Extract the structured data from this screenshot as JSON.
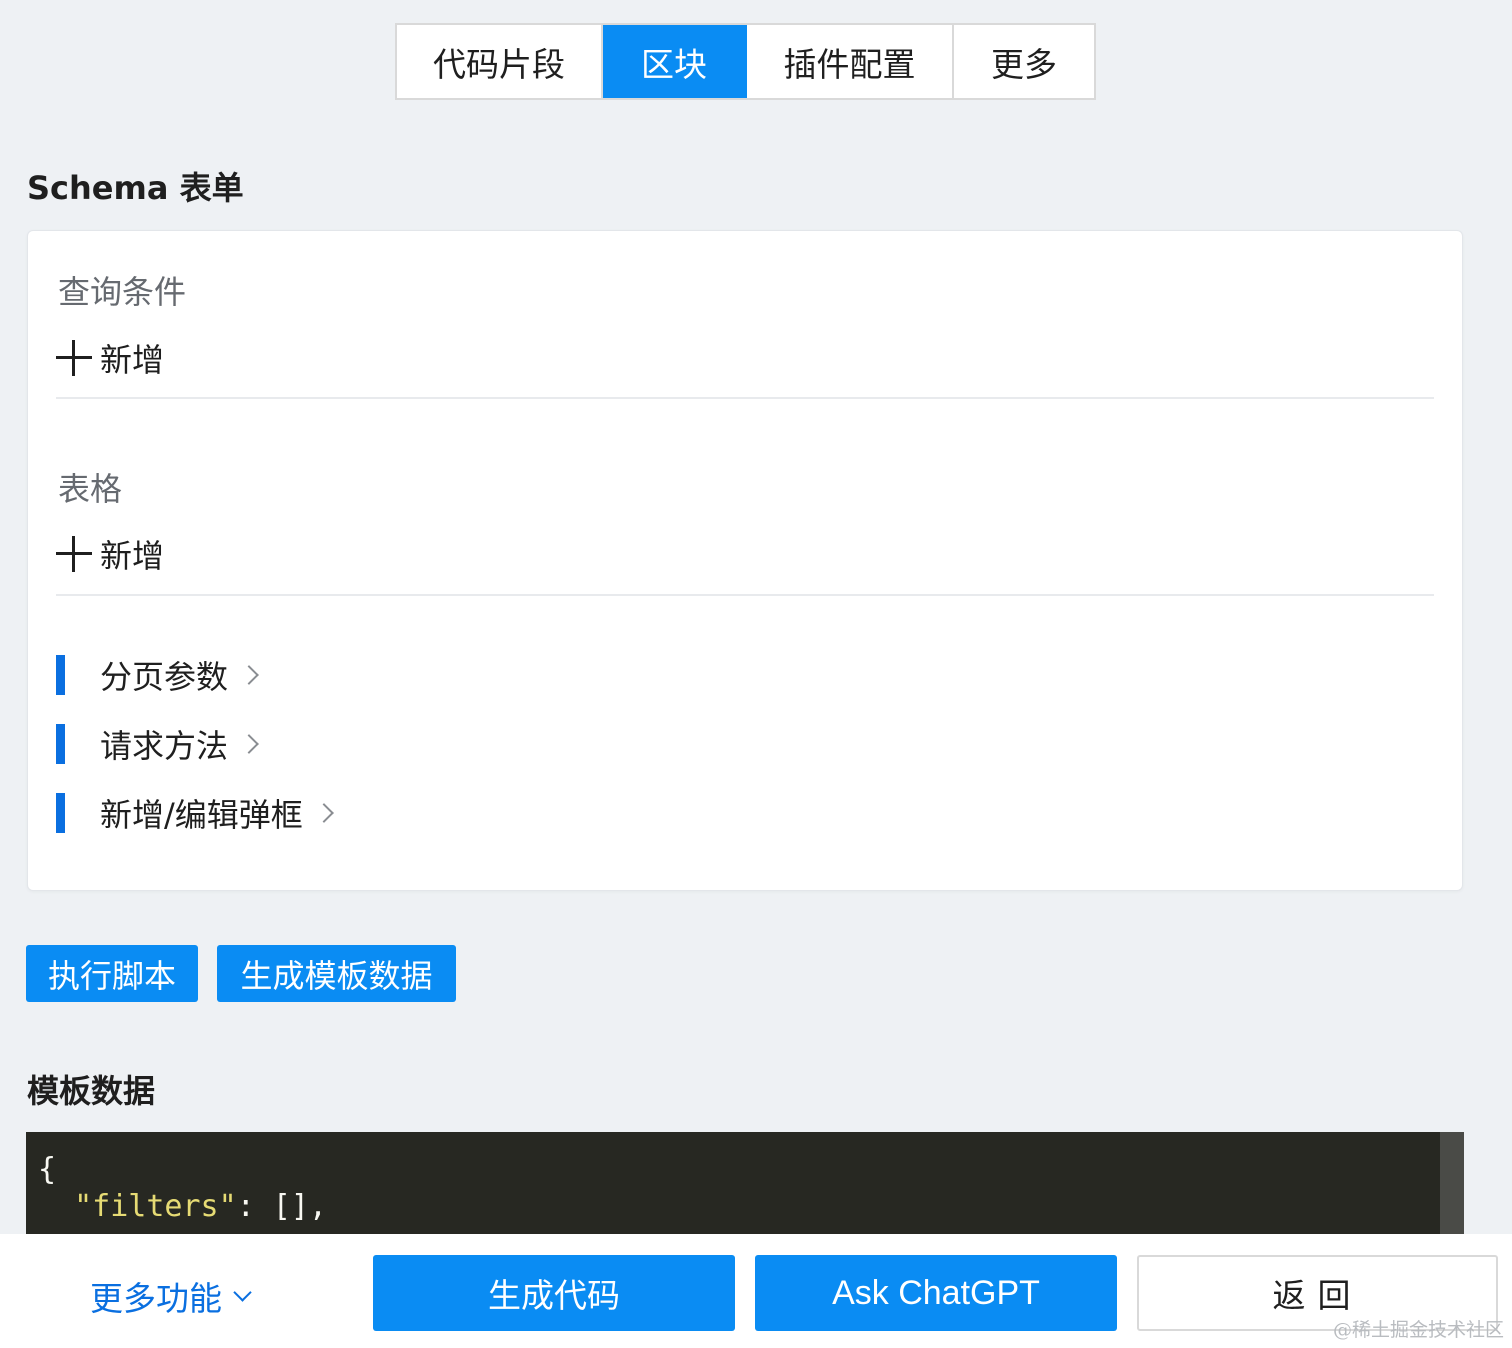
{
  "tabs": [
    {
      "label": "代码片段",
      "active": false
    },
    {
      "label": "区块",
      "active": true
    },
    {
      "label": "插件配置",
      "active": false
    },
    {
      "label": "更多",
      "active": false
    }
  ],
  "schema_section": {
    "title": "Schema 表单",
    "groups": [
      {
        "label": "查询条件",
        "add_label": "新增"
      },
      {
        "label": "表格",
        "add_label": "新增"
      }
    ],
    "params": [
      {
        "label": "分页参数"
      },
      {
        "label": "请求方法"
      },
      {
        "label": "新增/编辑弹框"
      }
    ]
  },
  "actions": {
    "run_script": "执行脚本",
    "generate_template": "生成模板数据"
  },
  "template_section": {
    "title": "模板数据",
    "code": {
      "line1": "{",
      "line2_key": "\"filters\"",
      "line2_rest": ": [],"
    }
  },
  "bottom_bar": {
    "more_features": "更多功能",
    "generate_code": "生成代码",
    "ask_chatgpt": "Ask ChatGPT",
    "back": "返回"
  },
  "watermark": "@稀土掘金技术社区",
  "colors": {
    "primary": "#0a8cf3",
    "accent_bar": "#0a6fe0",
    "code_bg": "#272822",
    "code_string": "#e6db74"
  }
}
